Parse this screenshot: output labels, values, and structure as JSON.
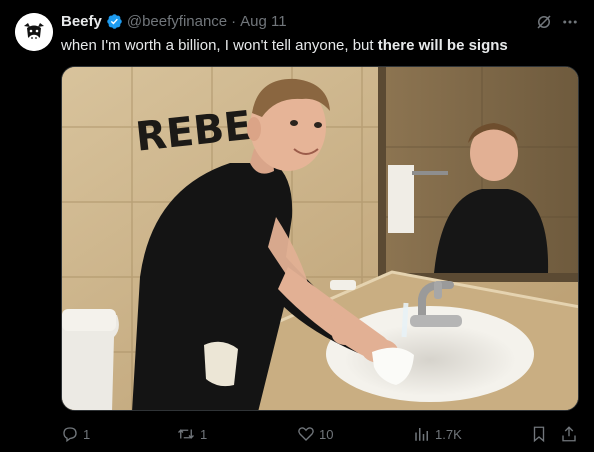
{
  "author": {
    "name": "Beefy",
    "handle": "@beefyfinance",
    "date": "Aug 11",
    "separator": "·"
  },
  "tweet": {
    "text_plain": "when I'm worth a billion, I won't tell anyone, but ",
    "text_bold": "there will be signs"
  },
  "media": {
    "wall_text": "REBEL"
  },
  "actions": {
    "replies": "1",
    "retweets": "1",
    "likes": "10",
    "views": "1.7K"
  },
  "colors": {
    "background": "#000000",
    "text": "#e7e9ea",
    "secondary": "#71767b",
    "verified": "#1d9bf0"
  },
  "icons": {
    "verified": "verified-badge-icon",
    "grok": "grok-icon",
    "more": "more-icon",
    "reply": "reply-icon",
    "retweet": "retweet-icon",
    "like": "heart-icon",
    "views": "views-icon",
    "bookmark": "bookmark-icon",
    "share": "share-icon"
  }
}
